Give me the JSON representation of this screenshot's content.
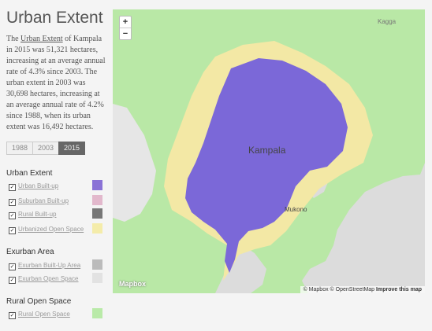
{
  "sidebar": {
    "title": "Urban Extent",
    "description": {
      "pre": "The ",
      "link": "Urban Extent",
      "post": " of Kampala in 2015 was 51,321 hectares, increasing at an average annual rate of 4.3% since 2003. The urban extent in 2003 was 30,698 hectares, increasing at an average annual rate of 4.2% since 1988, when its urban extent was 16,492 hectares."
    },
    "years": [
      "1988",
      "2003",
      "2015"
    ],
    "selected_year": "2015",
    "sections": [
      {
        "heading": "Urban Extent",
        "items": [
          {
            "label": "Urban Built-up",
            "color": "#8a72d6",
            "checked": true
          },
          {
            "label": "Suburban Built-up",
            "color": "#e2b8cc",
            "checked": true
          },
          {
            "label": "Rural Built-up",
            "color": "#777777",
            "checked": true
          },
          {
            "label": "Urbanized Open Space",
            "color": "#f4ecaa",
            "checked": true
          }
        ]
      },
      {
        "heading": "Exurban Area",
        "items": [
          {
            "label": "Exurban Built-Up Area",
            "color": "#bbbbbb",
            "checked": true
          },
          {
            "label": "Exurban Open Space",
            "color": "#e2e2e2",
            "checked": true
          }
        ]
      },
      {
        "heading": "Rural Open Space",
        "items": [
          {
            "label": "Rural Open Space",
            "color": "#b9eaa8",
            "checked": true
          }
        ]
      }
    ]
  },
  "map": {
    "zoom_in": "+",
    "zoom_out": "−",
    "labels": {
      "city": "Kampala",
      "town1": "Mukono",
      "town2": "Kagga"
    },
    "logo": "Mapbox",
    "attribution": {
      "mapbox": "© Mapbox",
      "osm": "© OpenStreetMap",
      "improve": "Improve this map"
    },
    "colors": {
      "land": "#b9e8a6",
      "water": "#dcdcdc",
      "urban": "#7b68d8",
      "periurban": "#f3e8a5"
    }
  }
}
